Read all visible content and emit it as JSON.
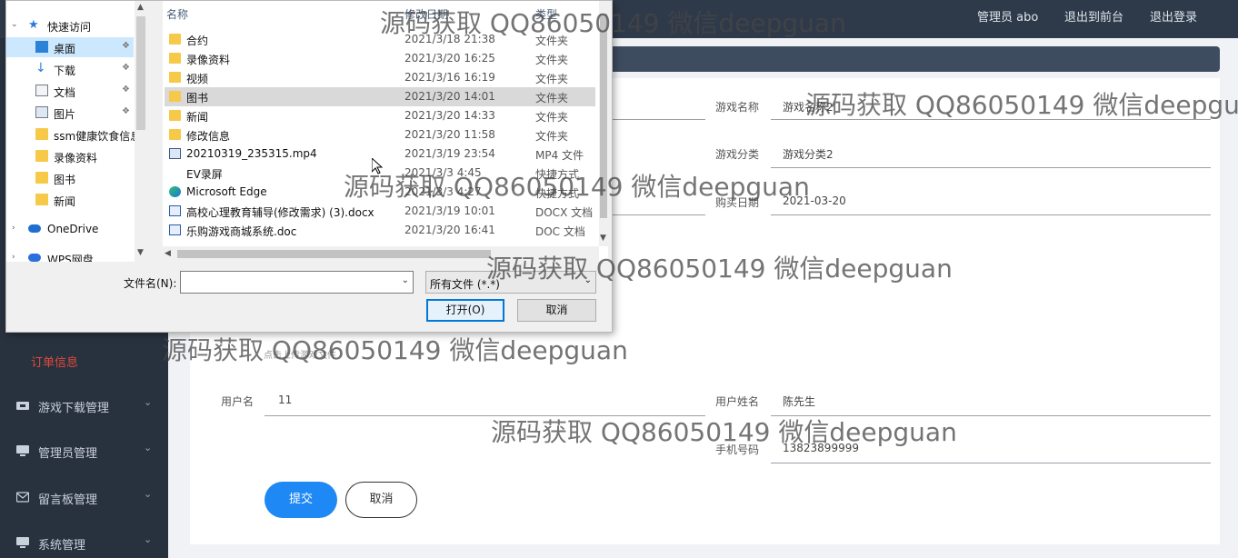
{
  "header": {
    "admin_user": "管理员 abo",
    "back_to_front": "退出到前台",
    "logout": "退出登录"
  },
  "sidebar": {
    "active_item": "订单信息",
    "menus": [
      {
        "label": "游戏下载管理",
        "icon": "download-icon"
      },
      {
        "label": "管理员管理",
        "icon": "monitor-icon"
      },
      {
        "label": "留言板管理",
        "icon": "mail-icon"
      },
      {
        "label": "系统管理",
        "icon": "monitor-icon"
      }
    ]
  },
  "form": {
    "game_name_label": "游戏名称",
    "game_name_value": "游戏名称2",
    "game_category_label": "游戏分类",
    "game_category_value": "游戏分类2",
    "purchase_date_label": "购买日期",
    "purchase_date_value": "2021-03-20",
    "upload_hint": "点击上传游戏文件",
    "username_label": "用户名",
    "username_value": "11",
    "realname_label": "用户姓名",
    "realname_value": "陈先生",
    "phone_label": "手机号码",
    "phone_value": "13823899999",
    "submit_label": "提交",
    "cancel_label": "取消"
  },
  "dialog": {
    "nav": {
      "quick_access": "快速访问",
      "items": [
        {
          "label": "桌面",
          "pinned": true
        },
        {
          "label": "下载",
          "pinned": true
        },
        {
          "label": "文档",
          "pinned": true
        },
        {
          "label": "图片",
          "pinned": true
        },
        {
          "label": "ssm健康饮食信息",
          "pinned": false
        },
        {
          "label": "录像资料",
          "pinned": false
        },
        {
          "label": "图书",
          "pinned": false
        },
        {
          "label": "新闻",
          "pinned": false
        }
      ],
      "onedrive": "OneDrive",
      "wps": "WPS网盘"
    },
    "columns": {
      "name": "名称",
      "date": "修改日期",
      "type": "类型"
    },
    "files": [
      {
        "name": "合约",
        "date": "2021/3/18 21:38",
        "type": "文件夹",
        "icon": "folder-icon"
      },
      {
        "name": "录像资料",
        "date": "2021/3/20 16:25",
        "type": "文件夹",
        "icon": "folder-icon"
      },
      {
        "name": "视频",
        "date": "2021/3/16 16:19",
        "type": "文件夹",
        "icon": "folder-icon"
      },
      {
        "name": "图书",
        "date": "2021/3/20 14:01",
        "type": "文件夹",
        "icon": "folder-icon"
      },
      {
        "name": "新闻",
        "date": "2021/3/20 14:33",
        "type": "文件夹",
        "icon": "folder-icon"
      },
      {
        "name": "修改信息",
        "date": "2021/3/20 11:58",
        "type": "文件夹",
        "icon": "folder-icon"
      },
      {
        "name": "20210319_235315.mp4",
        "date": "2021/3/19 23:54",
        "type": "MP4 文件",
        "icon": "video-file-icon"
      },
      {
        "name": "EV录屏",
        "date": "2021/3/3 4:45",
        "type": "快捷方式",
        "icon": "shortcut-icon"
      },
      {
        "name": "Microsoft Edge",
        "date": "2021/3/3 4:27",
        "type": "快捷方式",
        "icon": "edge-icon"
      },
      {
        "name": "高校心理教育辅导(修改需求) (3).docx",
        "date": "2021/3/19 10:01",
        "type": "DOCX 文档",
        "icon": "docx-icon"
      },
      {
        "name": "乐购游戏商城系统.doc",
        "date": "2021/3/20 16:41",
        "type": "DOC 文档",
        "icon": "doc-icon"
      }
    ],
    "filename_label": "文件名(N):",
    "filename_value": "",
    "filetype_value": "所有文件 (*.*)",
    "open_label": "打开(O)",
    "cancel_label": "取消"
  },
  "watermark": "源码获取 QQ86050149 微信deepguan"
}
